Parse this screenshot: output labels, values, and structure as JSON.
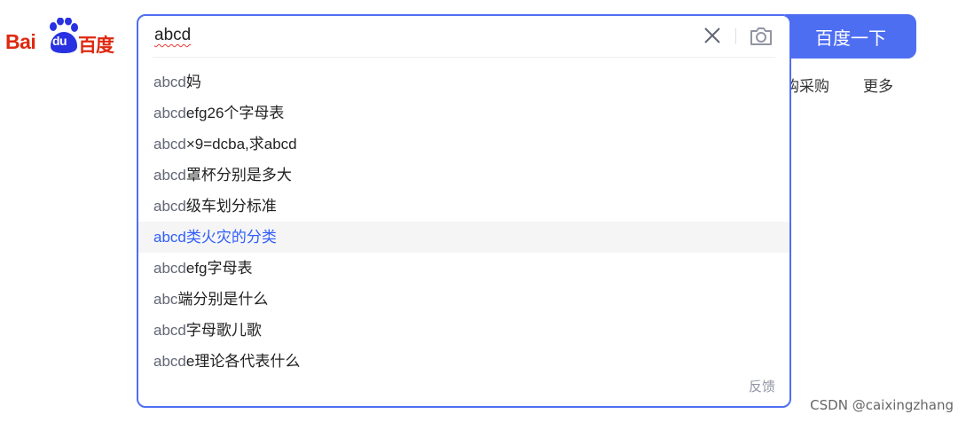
{
  "logo": {
    "text_latin": "Bai",
    "text_du": "du",
    "text_cn": "百度"
  },
  "search": {
    "query": "abcd",
    "button_label": "百度一下",
    "clear_icon": "close-icon",
    "camera_icon": "camera-icon"
  },
  "suggestions": [
    {
      "prefix": "abcd",
      "rest": "妈"
    },
    {
      "prefix": "abcd",
      "rest": "efg26个字母表"
    },
    {
      "prefix": "abcd",
      "rest": "×9=dcba,求abcd"
    },
    {
      "prefix": "abcd",
      "rest": "罩杯分别是多大"
    },
    {
      "prefix": "abcd",
      "rest": "级车划分标准"
    },
    {
      "prefix": "abcd",
      "rest": "类火灾的分类",
      "active": true
    },
    {
      "prefix": "abcd",
      "rest": "efg字母表"
    },
    {
      "prefix": "abc",
      "rest": "端分别是什么"
    },
    {
      "prefix": "abcd",
      "rest": "字母歌儿歌"
    },
    {
      "prefix": "abcd",
      "rest": "e理论各代表什么"
    }
  ],
  "feedback_label": "反馈",
  "nav": {
    "purchase": "购采购",
    "more": "更多"
  },
  "watermark": "CSDN @caixingzhang",
  "colors": {
    "brand_blue": "#4e6ef2",
    "active_link": "#315efb",
    "logo_red": "#de2910"
  }
}
